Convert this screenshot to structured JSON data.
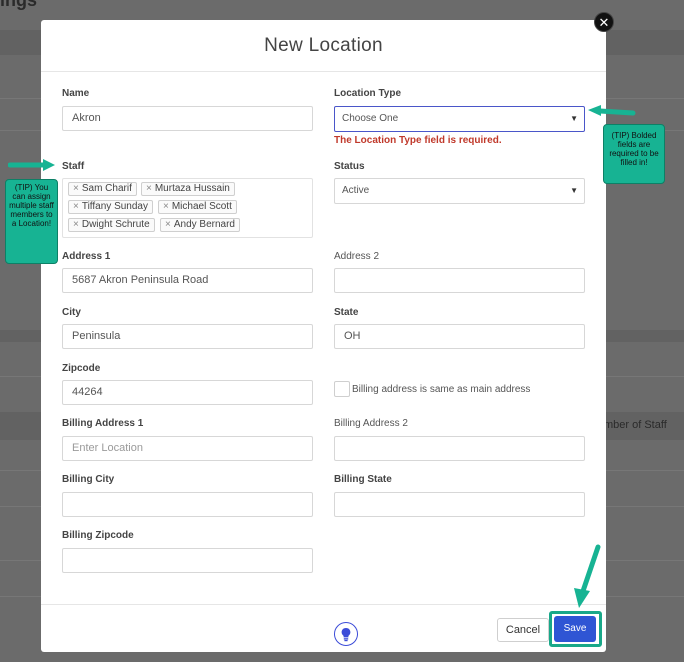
{
  "background": {
    "page_title": "ings",
    "column_header": "mber of Staff"
  },
  "modal": {
    "title": "New Location",
    "close_glyph": "✕"
  },
  "form": {
    "name": {
      "label": "Name",
      "value": "Akron"
    },
    "location_type": {
      "label": "Location Type",
      "value": "Choose One",
      "error": "The Location Type field is required."
    },
    "staff": {
      "label": "Staff",
      "remove_glyph": "×",
      "tags": [
        "Sam Charif",
        "Murtaza Hussain",
        "Tiffany Sunday",
        "Michael Scott",
        "Dwight Schrute",
        "Andy Bernard"
      ]
    },
    "status": {
      "label": "Status",
      "value": "Active"
    },
    "address1": {
      "label": "Address 1",
      "value": "5687 Akron Peninsula Road"
    },
    "address2": {
      "label": "Address 2",
      "value": ""
    },
    "city": {
      "label": "City",
      "value": "Peninsula"
    },
    "state": {
      "label": "State",
      "value": "OH"
    },
    "zipcode": {
      "label": "Zipcode",
      "value": "44264"
    },
    "billing_same": {
      "label": "Billing address is same as main address",
      "checked": false
    },
    "billing_address1": {
      "label": "Billing Address 1",
      "placeholder": "Enter Location",
      "value": ""
    },
    "billing_address2": {
      "label": "Billing Address 2",
      "value": ""
    },
    "billing_city": {
      "label": "Billing City",
      "value": ""
    },
    "billing_state": {
      "label": "Billing State",
      "value": ""
    },
    "billing_zipcode": {
      "label": "Billing Zipcode",
      "value": ""
    }
  },
  "footer": {
    "cancel_label": "Cancel",
    "save_label": "Save",
    "help_icon": "lightbulb-icon"
  },
  "tips": {
    "staff": "(TIP) You can assign multiple staff members to a Location!",
    "bold_fields": "(TIP) Bolded fields are required to be filled in!"
  },
  "colors": {
    "accent": "#2f55d4",
    "tip": "#17b393",
    "error": "#c0392b"
  }
}
